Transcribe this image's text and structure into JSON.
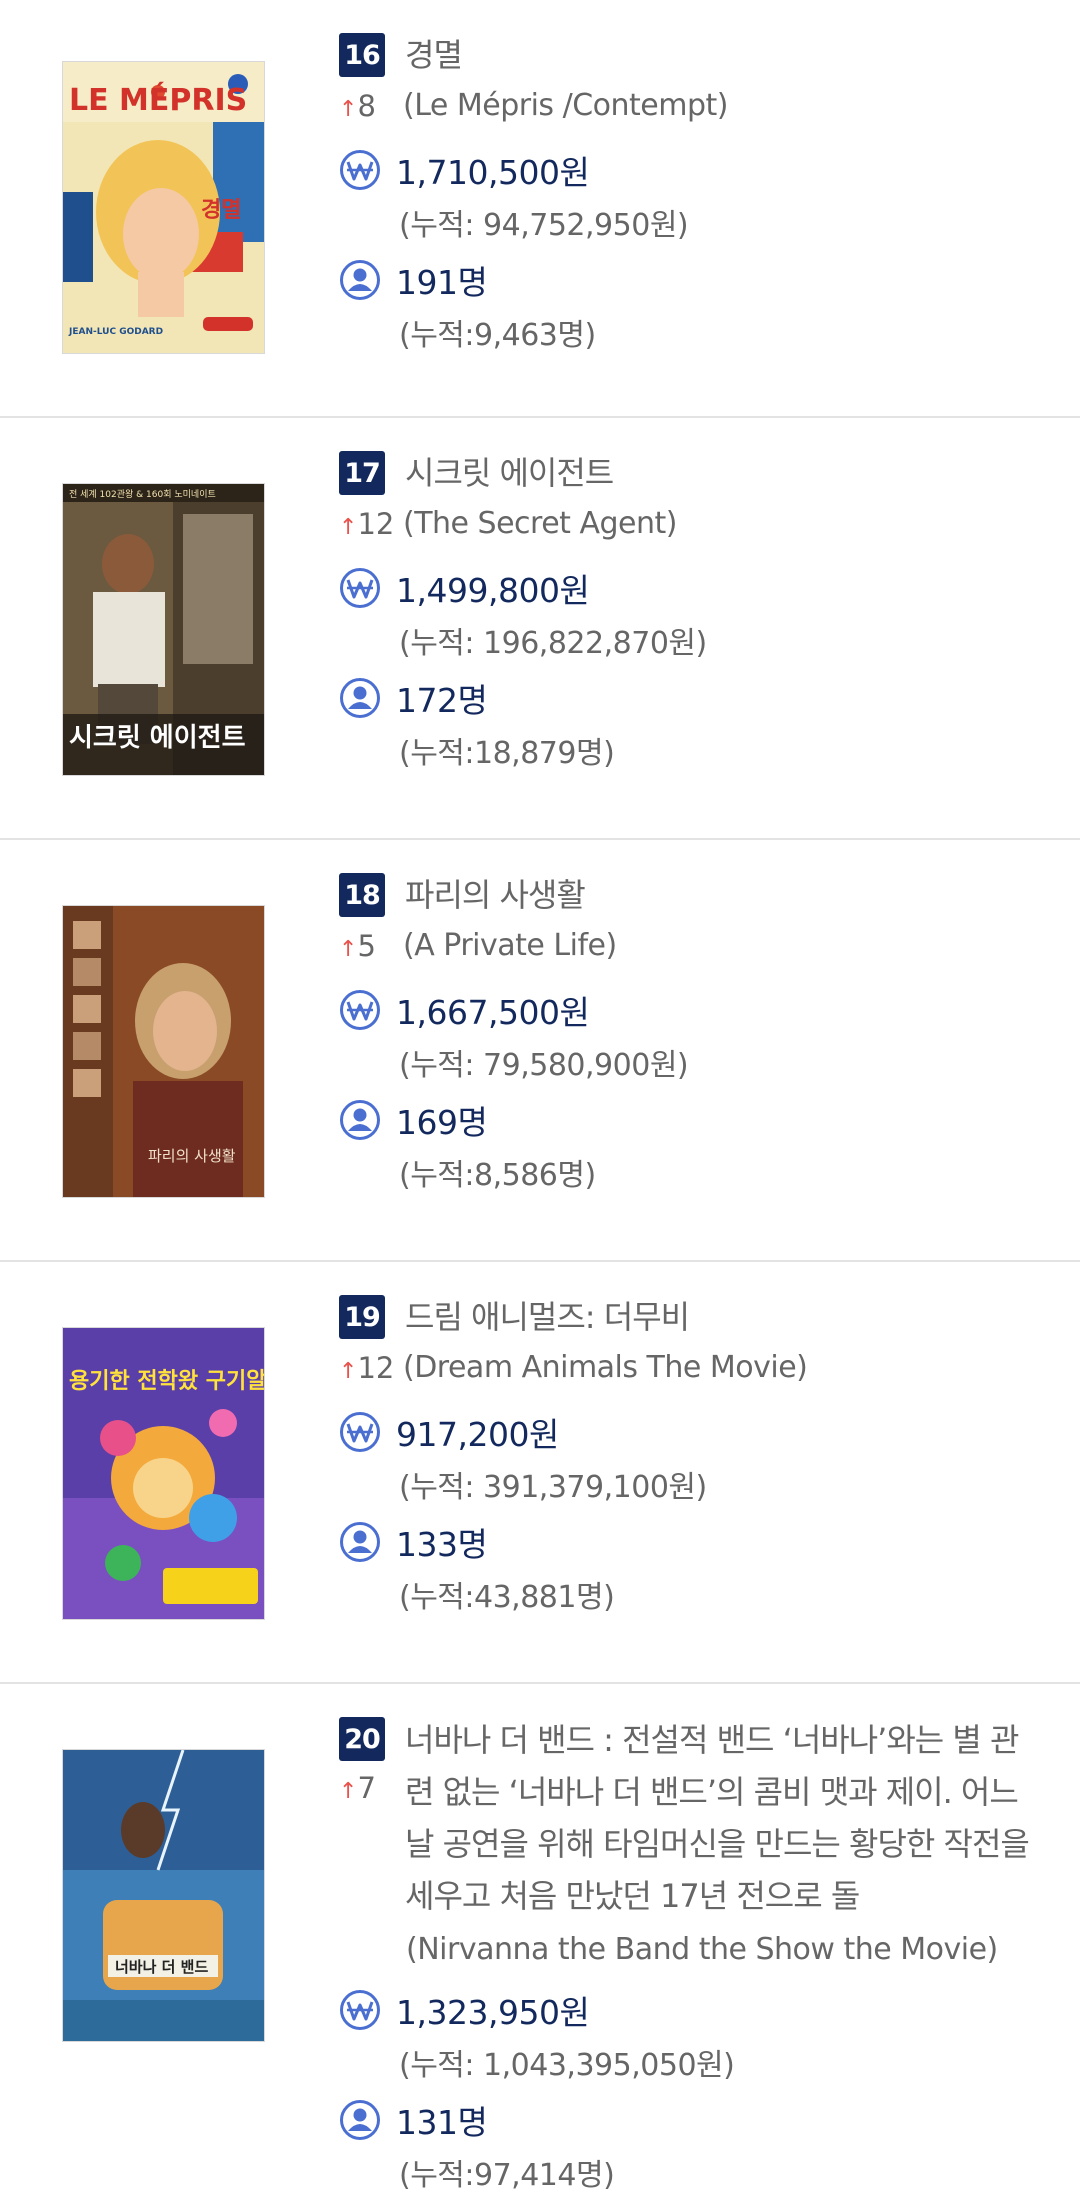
{
  "colors": {
    "rank_bg": "#13295e",
    "accent_arrow": "#e8534c",
    "value_text": "#13295e",
    "icon_blue": "#4a6fd1"
  },
  "icons": {
    "revenue": "won-circle-icon",
    "audience": "person-circle-icon",
    "change": "arrow-up-icon"
  },
  "entries": [
    {
      "rank": "16",
      "change": "8",
      "title": "경멸",
      "original_title": "(Le Mépris /Contempt)",
      "revenue": "1,710,500원",
      "revenue_cum": "(누적: 94,752,950원)",
      "audience": "191명",
      "audience_cum": "(누적:9,463명)"
    },
    {
      "rank": "17",
      "change": "12",
      "title": "시크릿 에이전트",
      "original_title": "(The Secret Agent)",
      "revenue": "1,499,800원",
      "revenue_cum": "(누적: 196,822,870원)",
      "audience": "172명",
      "audience_cum": "(누적:18,879명)"
    },
    {
      "rank": "18",
      "change": "5",
      "title": "파리의 사생활",
      "original_title": "(A Private Life)",
      "revenue": "1,667,500원",
      "revenue_cum": "(누적: 79,580,900원)",
      "audience": "169명",
      "audience_cum": "(누적:8,586명)"
    },
    {
      "rank": "19",
      "change": "12",
      "title": "드림 애니멀즈: 더무비",
      "original_title": "(Dream Animals The Movie)",
      "revenue": "917,200원",
      "revenue_cum": "(누적: 391,379,100원)",
      "audience": "133명",
      "audience_cum": "(누적:43,881명)"
    },
    {
      "rank": "20",
      "change": "7",
      "title": "너바나 더 밴드 : 전설적 밴드 ‘너바나’와는 별 관련 없는 ‘너바나 더 밴드’의 콤비 맷과 제이. 어느 날 공연을 위해 타임머신을 만드는 황당한 작전을 세우고 처음 만났던 17년 전으로 돌",
      "original_title": "(Nirvanna the Band the Show the Movie)",
      "revenue": "1,323,950원",
      "revenue_cum": "(누적: 1,043,395,050원)",
      "audience": "131명",
      "audience_cum": "(누적:97,414명)"
    }
  ],
  "posters": [
    {
      "text_top": "LE MÉPRIS",
      "text_kor": "경멸",
      "text_bottom": "JEAN-LUC GODARD"
    },
    {
      "text_top": "전 세계 102관왕 & 160회 노미네이트",
      "text_kor": "시크릿 에이전트"
    },
    {
      "text_top": "",
      "text_kor": "파리의 사생활"
    },
    {
      "text_top": "",
      "text_kor": "용기한 전학왔 구기알"
    },
    {
      "text_top": "",
      "text_kor": "너바나 더 밴드"
    }
  ]
}
